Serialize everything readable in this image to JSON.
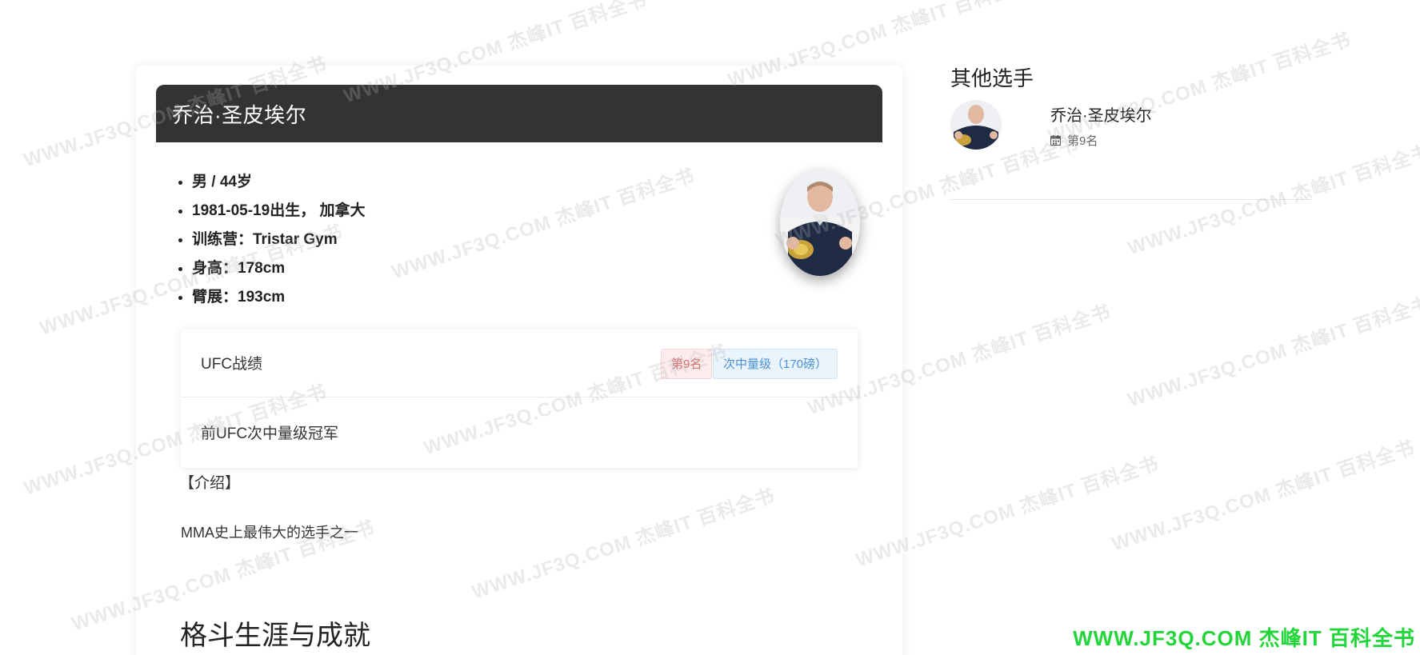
{
  "main": {
    "title": "乔治·圣皮埃尔",
    "info": [
      "男 / 44岁",
      "1981-05-19出生， 加拿大",
      "训练营：Tristar Gym",
      "身高：178cm",
      "臂展：193cm"
    ],
    "record": {
      "label": "UFC战绩",
      "rank_badge": "第9名",
      "weight_badge": "次中量级（170磅）",
      "body": "前UFC次中量级冠军"
    },
    "intro_title": "【介绍】",
    "intro_text": "MMA史上最伟大的选手之一",
    "section_heading": "格斗生涯与成就"
  },
  "sidebar": {
    "title": "其他选手",
    "items": [
      {
        "name": "乔治·圣皮埃尔",
        "rank": "第9名"
      }
    ]
  },
  "watermark": {
    "text": "WWW.JF3Q.COM 杰峰IT 百科全书",
    "corner_text": "WWW.JF3Q.COM 杰峰IT 百科全书"
  },
  "colors": {
    "title_bar": "#333333",
    "rank_badge_bg": "#fdeced",
    "rank_badge_text": "#d96a6a",
    "weight_badge_bg": "#eaf4fd",
    "weight_badge_text": "#4a91d3",
    "corner_watermark": "#22d63a"
  }
}
